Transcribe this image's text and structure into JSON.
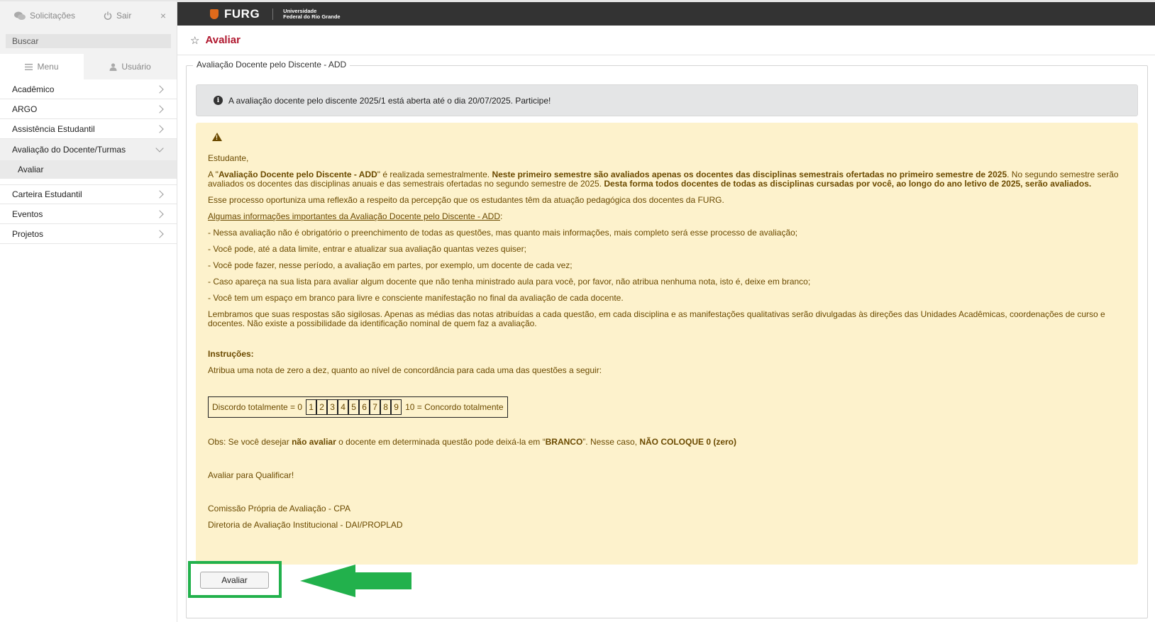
{
  "sidebar": {
    "requests_label": "Solicitações",
    "logout_label": "Sair",
    "close_label": "×",
    "search_placeholder": "Buscar",
    "tabs": {
      "menu": "Menu",
      "user": "Usuário"
    },
    "items": [
      {
        "label": "Acadêmico"
      },
      {
        "label": "ARGO"
      },
      {
        "label": "Assistência Estudantil"
      },
      {
        "label": "Avaliação do Docente/Turmas"
      },
      {
        "label": "Carteira Estudantil"
      },
      {
        "label": "Eventos"
      },
      {
        "label": "Projetos"
      }
    ],
    "subitem": "Avaliar"
  },
  "topbar": {
    "brand": "FURG",
    "university_line1": "Universidade",
    "university_line2": "Federal do Rio Grande"
  },
  "page": {
    "title": "Avaliar",
    "fieldset_legend": "Avaliação Docente pelo Discente - ADD",
    "info": "A avaliação docente pelo discente 2025/1 está aberta até o dia 20/07/2025. Participe!",
    "greeting": "Estudante,",
    "p1": {
      "a": "A \"",
      "b": "Avaliação Docente pelo Discente - ADD",
      "c": "\" é realizada semestralmente. ",
      "d": "Neste primeiro semestre são avaliados apenas os docentes das disciplinas semestrais ofertadas no primeiro semestre de 2025",
      "e": ". No segundo semestre serão avaliados os docentes das disciplinas anuais e das semestrais ofertadas no segundo semestre de 2025. ",
      "f": "Desta forma todos docentes de todas as disciplinas cursadas por você, ao longo do ano letivo de 2025, serão avaliados."
    },
    "p2": "Esse processo oportuniza uma reflexão a respeito da percepção que os estudantes têm da atuação pedagógica dos docentes da FURG.",
    "info_title": "Algumas informações importantes da Avaliação Docente pelo Discente - ADD",
    "bullets": [
      "- Nessa avaliação não é obrigatório o preenchimento de todas as questões, mas quanto mais informações, mais completo será esse processo de avaliação;",
      "- Você pode, até a data limite, entrar e atualizar sua avaliação quantas vezes quiser;",
      "- Você pode fazer, nesse período, a avaliação em partes, por exemplo, um docente de cada vez;",
      "- Caso apareça na sua lista para avaliar algum docente que não tenha ministrado aula para você, por favor, não atribua nenhuma nota, isto é, deixe em branco;",
      "- Você tem um espaço em branco para livre e consciente manifestação no final da avaliação de cada docente."
    ],
    "p3": "Lembramos que suas respostas são sigilosas. Apenas as médias das notas atribuídas a cada questão, em cada disciplina e as manifestações qualitativas serão divulgadas às direções das Unidades Acadêmicas, coordenações de curso e docentes. Não existe a possibilidade da identificação nominal de quem faz a avaliação.",
    "instructions_title": "Instruções:",
    "instructions": "Atribua uma nota de zero a dez, quanto ao nível de concordância para cada uma das questões a seguir:",
    "scale_left": "Discordo totalmente = 0",
    "scale_numbers": [
      "1",
      "2",
      "3",
      "4",
      "5",
      "6",
      "7",
      "8",
      "9"
    ],
    "scale_right": "10 = Concordo totalmente",
    "obs": {
      "a": "Obs: Se você desejar ",
      "b": "não avaliar",
      "c": " o docente em determinada questão pode deixá-la em “",
      "d": "BRANCO",
      "e": "”. Nesse caso, ",
      "f": "NÃO COLOQUE 0 (zero)"
    },
    "motto": "Avaliar para Qualificar!",
    "sign1": "Comissão Própria de Avaliação - CPA",
    "sign2": "Diretoria de Avaliação Institucional - DAI/PROPLAD",
    "button": "Avaliar"
  },
  "colors": {
    "title_red": "#b0182f",
    "topbar": "#333333",
    "warning_bg": "#fdf2cc",
    "warning_text": "#6b4a00",
    "highlight_green": "#22b14c"
  }
}
